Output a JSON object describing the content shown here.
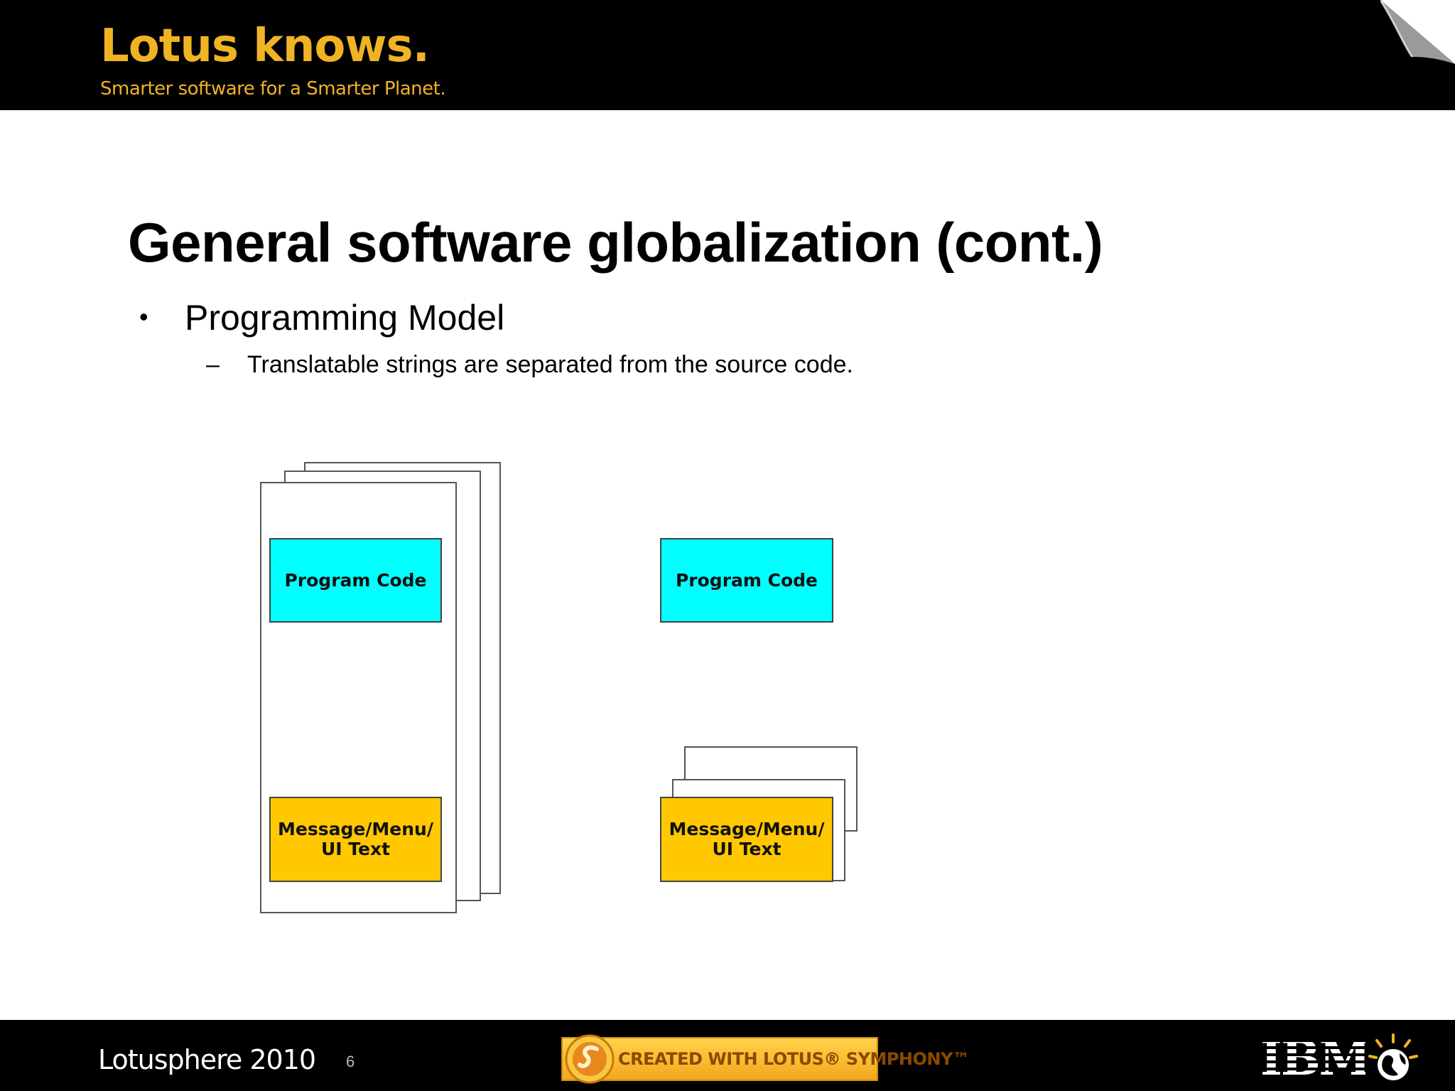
{
  "header": {
    "brand_title": "Lotus knows.",
    "tagline": "Smarter software for a Smarter Planet."
  },
  "slide": {
    "title": "General software globalization (cont.)",
    "bullet": "Programming Model",
    "sub_bullet": "Translatable strings are separated from the source code."
  },
  "diagram": {
    "left": {
      "code_label": "Program Code",
      "text_label_line1": "Message/Menu/",
      "text_label_line2": "UI Text"
    },
    "right": {
      "code_label": "Program Code",
      "text_label_line1": "Message/Menu/",
      "text_label_line2": "UI Text"
    }
  },
  "footer": {
    "event": "Lotusphere 2010",
    "page_number": "6",
    "badge_text": "CREATED WITH LOTUS® SYMPHONY™",
    "logo_text": "IBM"
  },
  "colors": {
    "brand_gold": "#f0b323",
    "code_box": "#00ffff",
    "text_box": "#ffc800"
  }
}
